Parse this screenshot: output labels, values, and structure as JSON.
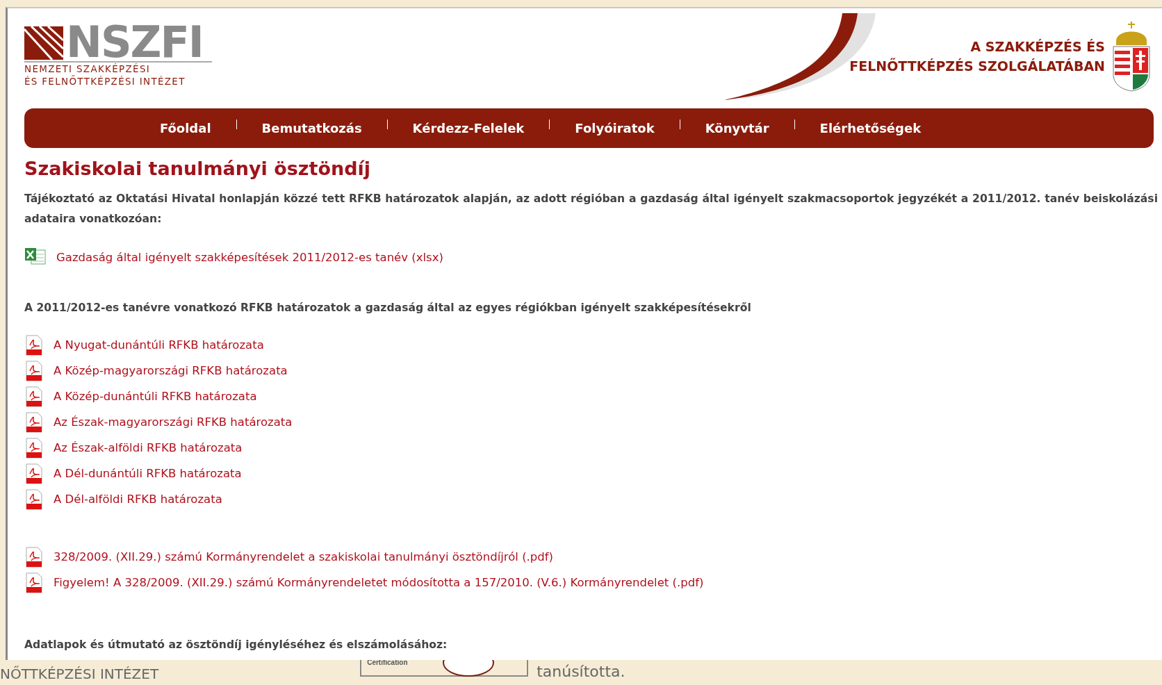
{
  "header": {
    "logo_mark": "NSZFI",
    "logo_lines": [
      "NEMZETI SZAKKÉPZÉSI",
      "ÉS FELNŐTTKÉPZÉSI INTÉZET"
    ],
    "slogan_lines": [
      "A SZAKKÉPZÉS ÉS",
      "FELNŐTTKÉPZÉS SZOLGÁLATÁBAN"
    ]
  },
  "nav": [
    "Főoldal",
    "Bemutatkozás",
    "Kérdezz-Felelek",
    "Folyóiratok",
    "Könyvtár",
    "Elérhetőségek"
  ],
  "content": {
    "title": "Szakiskolai tanulmányi ösztöndíj",
    "intro": "Tájékoztató az Oktatási Hivatal honlapján közzé tett RFKB határozatok alapján, az adott régióban a gazdaság által igényelt szakmacsoportok jegyzékét a 2011/2012. tanév beiskolázási adataira vonatkozóan:",
    "spreadsheet_link": "Gazdaság által igényelt szakképesítések 2011/2012-es tanév (xlsx)",
    "regions_heading": "A 2011/2012-es tanévre vonatkozó RFKB határozatok a gazdaság által az egyes régiókban igényelt szakképesítésekről",
    "region_links": [
      "A Nyugat-dunántúli RFKB határozata",
      "A Közép-magyarországi RFKB határozata",
      "A Közép-dunántúli RFKB határozata",
      "Az Észak-magyarországi RFKB határozata",
      "Az Észak-alföldi RFKB határozata",
      "A Dél-dunántúli RFKB határozata",
      "A Dél-alföldi RFKB határozata"
    ],
    "decree_links": [
      "328/2009. (XII.29.) számú Kormányrendelet a szakiskolai tanulmányi ösztöndíjról (.pdf)",
      "Figyelem! A 328/2009. (XII.29.) számú Kormányrendeletet módosította a 157/2010. (V.6.) Kormányrendelet (.pdf)"
    ],
    "forms_heading": "Adatlapok és útmutató az ösztöndíj igényléséhez és elszámolásához:"
  },
  "footer": {
    "logo_text": "NŐTTKÉPZÉSI INTÉZET",
    "badge_text": "Certification",
    "certified_text": "tanúsította."
  }
}
